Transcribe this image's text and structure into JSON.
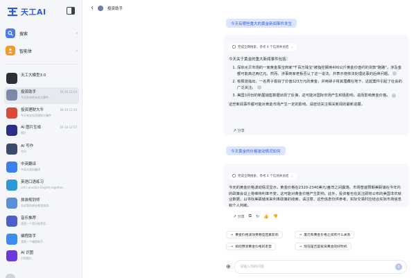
{
  "brand": {
    "name": "天工AI",
    "color": "#2f5bd6"
  },
  "nav": [
    {
      "label": "搜索",
      "icon": "search-icon",
      "color": "#4a7cf0"
    },
    {
      "label": "智能体",
      "icon": "agent-icon",
      "color": "#f09a2a"
    }
  ],
  "agents": [
    {
      "name": "天工大模型3.0",
      "time": "",
      "sub": "",
      "color": "#2b2f3a",
      "icon": "tiangong-model-icon"
    },
    {
      "name": "投资助手",
      "time": "04-16 12:54",
      "sub": "今天发布的有关大事件...",
      "color": "#7b8aa8",
      "icon": "investment-icon",
      "active": true
    },
    {
      "name": "投资理财大牛",
      "time": "04-16 12:59",
      "sub": "今天有关投资理财大事件",
      "color": "#d94a3a",
      "icon": "finance-icon"
    },
    {
      "name": "AI 图片生成",
      "time": "04-16 12:53",
      "sub": "图片",
      "color": "#2a2f8a",
      "icon": "image-gen-icon"
    },
    {
      "name": "AI 写作",
      "time": "",
      "sub": "写作",
      "color": "#3a4a6a",
      "icon": "writing-icon"
    },
    {
      "name": "中英翻译",
      "time": "",
      "sub": "中英文双向翻译",
      "color": "#3d7ef0",
      "icon": "translate-icon"
    },
    {
      "name": "英语口语练习",
      "time": "",
      "sub": "Let's practice English together...",
      "color": "#2a9bd8",
      "icon": "english-icon"
    },
    {
      "name": "旅游规划师",
      "time": "",
      "sub": "告诉我你想去哪里旅游...",
      "color": "#5a8fd8",
      "icon": "travel-icon"
    },
    {
      "name": "音乐推荐",
      "time": "",
      "sub": "我是一个音乐推荐官...",
      "color": "#4a5fc8",
      "icon": "music-icon"
    },
    {
      "name": "编程助手",
      "time": "",
      "sub": "我是一个编程助手...",
      "color": "#3d8af0",
      "icon": "code-icon"
    },
    {
      "name": "AI 识图",
      "time": "",
      "sub": "识别图片...",
      "color": "#6a3ad8",
      "icon": "vision-icon"
    }
  ],
  "topbar": {
    "title": "投资助手"
  },
  "conversation": {
    "q1": "今天有哪些重大的黄金新闻事件发生",
    "a1": {
      "search": "完成全网搜索，参考 4 个信源并总结",
      "intro": "今天关于黄金的重大新闻事件包括：",
      "items": [
        "深圳水贝市场的一家黄金珠宝商家\"千百万珠宝\"被指控挪用400公斤黄金价值约的货款\"跑路\"，涉及金额可能高达两亿元。然而，涉事商家老板否认了这一说法，并表示将依法处理此事的后续问题。",
        "有报道指出，一名男子偷窃了价值323万元的黄金，并用袜子将其埋藏在地下，这起案件引起了社会的广泛关注。",
        "美国3月份的新屋销售数据出现了反弹，这可能对国际市场产生积极影响，进而影响黄金价格。"
      ],
      "outro": "这些新闻事件都可能对黄金市场产生一定的影响，请密切关注相关新闻的最新进展。",
      "share": "分享"
    },
    "q2": "今天黄金的价格波动情况如何",
    "a2": {
      "search": "完成全网搜索，参考 4 个信源并总结",
      "para": "今天的黄金价格波动情况显示，黄金价格在2320-2340美元/盎司之间震荡。市场普遍预期美联储在今年内的政策会议上将维持利率不变，这可能对黄金价格产生影响。此外，投资者也在关注即将公布的美国非农就业数据，以寻找美联储未来利率政策的线索。请注意，这些信息仅供参考，实际交易时应结合实际市场信息和个人判断。",
      "share": "分享"
    },
    "suggestions": [
      "黄金价格波动受哪些因素影响",
      "美元和黄金价格之间有什么关系",
      "如何预测黄金价格的走势",
      "现在是否是投资黄金的好时机"
    ]
  },
  "input": {
    "placeholder": "请输入你的问题"
  }
}
